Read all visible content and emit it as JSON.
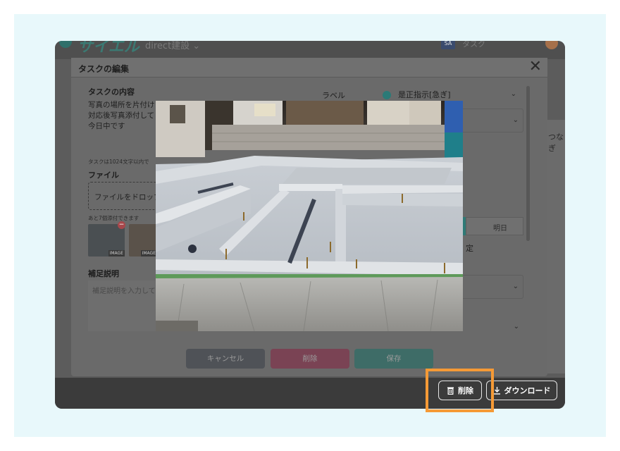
{
  "header": {
    "logo_text": "サイエル",
    "company": "direct建設 ⌄",
    "user_chip": "SA",
    "user_name": "タスク"
  },
  "right_strip_text": "つなぎ",
  "modal": {
    "title": "タスクの編集",
    "close_glyph": "✕",
    "task_content_label": "タスクの内容",
    "task_content_text": "写真の場所を片付け\n対応後写真添付して\n今日中です",
    "task_limit_note": "タスクは1024文字以内で",
    "file_label": "ファイル",
    "file_drop_text": "ファイルをドロップ",
    "file_remaining_note": "あと7個添付できます",
    "thumbnails": [
      {
        "label": "IMAGE"
      },
      {
        "label": "IMAGE"
      }
    ],
    "notes_label": "補足説明",
    "notes_placeholder": "補足説明を入力して",
    "label_field": {
      "label": "ラベル",
      "value": "是正指示[急ぎ]"
    },
    "date_tab_tomorrow": "明日",
    "date_row_text": "定",
    "buttons": {
      "cancel": "キャンセル",
      "delete": "削除",
      "save": "保存"
    }
  },
  "lightbox": {
    "delete_label": "削除",
    "download_label": "ダウンロード"
  },
  "colors": {
    "page_bg": "#e8f8fb",
    "highlight": "#f59a36",
    "accent_teal": "#2f7a76",
    "delete_pink": "#a5425e"
  }
}
